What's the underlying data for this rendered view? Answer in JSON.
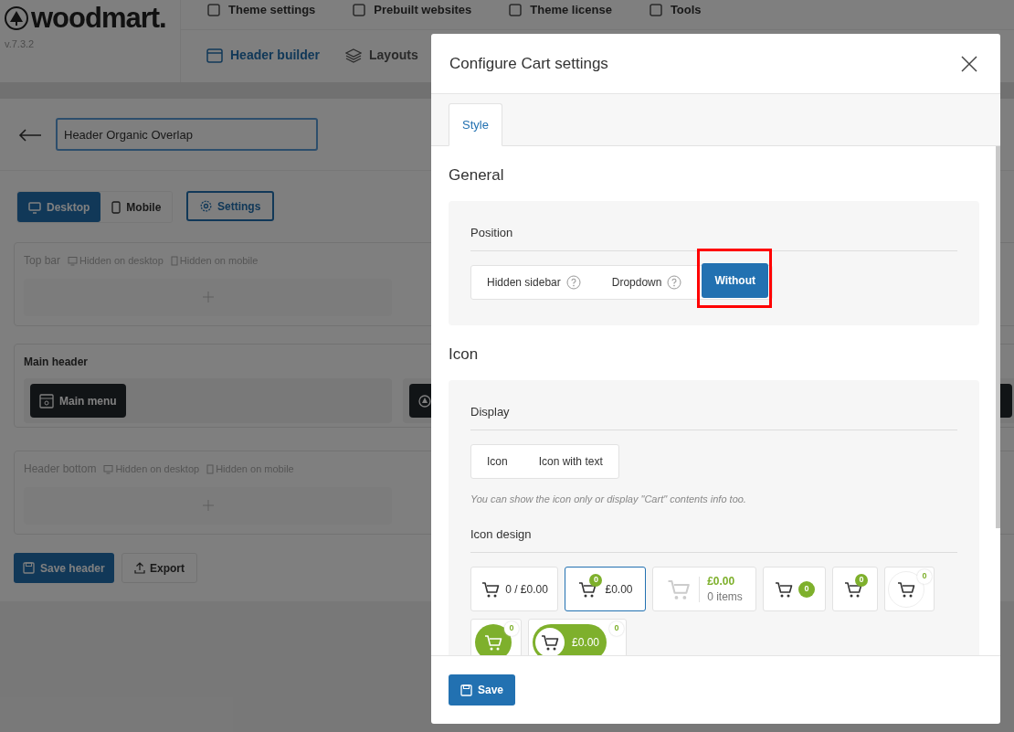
{
  "app": {
    "logo": "woodmart.",
    "version": "v.7.3.2",
    "top_menu": [
      {
        "label": "Theme settings"
      },
      {
        "label": "Prebuilt websites"
      },
      {
        "label": "Theme license"
      },
      {
        "label": "Tools"
      }
    ],
    "nav": [
      {
        "label": "Header builder",
        "selected": true
      },
      {
        "label": "Layouts",
        "selected": false
      }
    ]
  },
  "builder": {
    "header_name": "Header Organic Overlap",
    "device_tabs": [
      {
        "label": "Desktop",
        "selected": true
      },
      {
        "label": "Mobile",
        "selected": false
      }
    ],
    "settings_button": "Settings",
    "rows": [
      {
        "title": "Top bar",
        "hidden_tags": [
          {
            "kind": "desktop",
            "label": "Hidden on desktop"
          },
          {
            "kind": "mobile",
            "label": "Hidden on mobile"
          }
        ]
      },
      {
        "title": "Main header",
        "elements": [
          {
            "kind": "menu",
            "label": "Main menu"
          },
          {
            "kind": "logo"
          }
        ]
      },
      {
        "title": "Header bottom",
        "hidden_tags": [
          {
            "kind": "desktop",
            "label": "Hidden on desktop"
          },
          {
            "kind": "mobile",
            "label": "Hidden on mobile"
          }
        ]
      }
    ],
    "save_button": "Save header",
    "export_button": "Export"
  },
  "modal": {
    "title": "Configure Cart settings",
    "tabs": [
      {
        "label": "Style",
        "selected": true
      }
    ],
    "sections": [
      {
        "title": "General",
        "options": [
          {
            "label": "Position",
            "choices": [
              {
                "label": "Hidden sidebar",
                "help": true,
                "selected": false,
                "highlighted": false
              },
              {
                "label": "Dropdown",
                "help": true,
                "selected": false,
                "highlighted": false
              },
              {
                "label": "Without",
                "help": false,
                "selected": true,
                "highlighted": true
              }
            ]
          }
        ]
      },
      {
        "title": "Icon",
        "options": [
          {
            "label": "Display",
            "choices": [
              {
                "label": "Icon",
                "help": false,
                "selected": false,
                "highlighted": false
              },
              {
                "label": "Icon with text",
                "help": false,
                "selected": false,
                "highlighted": false
              }
            ],
            "hint": "You can show the icon only or display \"Cart\" contents info too."
          },
          {
            "label": "Icon design",
            "designs": [
              {
                "kind": "count_total",
                "text": "0 / £0.00",
                "selected": false
              },
              {
                "kind": "badge_total",
                "count": "0",
                "total": "£0.00",
                "selected": true
              },
              {
                "kind": "stacked",
                "total": "£0.00",
                "items": "0 items",
                "selected": false
              },
              {
                "kind": "inline_badge",
                "count": "0",
                "selected": false
              },
              {
                "kind": "badge",
                "count": "0",
                "selected": false
              },
              {
                "kind": "circle",
                "count": "0",
                "selected": false
              },
              {
                "kind": "filled_circle",
                "count": "0",
                "selected": false
              },
              {
                "kind": "pill",
                "count": "0",
                "total": "£0.00",
                "selected": false
              }
            ]
          }
        ]
      }
    ],
    "save_button": "Save"
  }
}
